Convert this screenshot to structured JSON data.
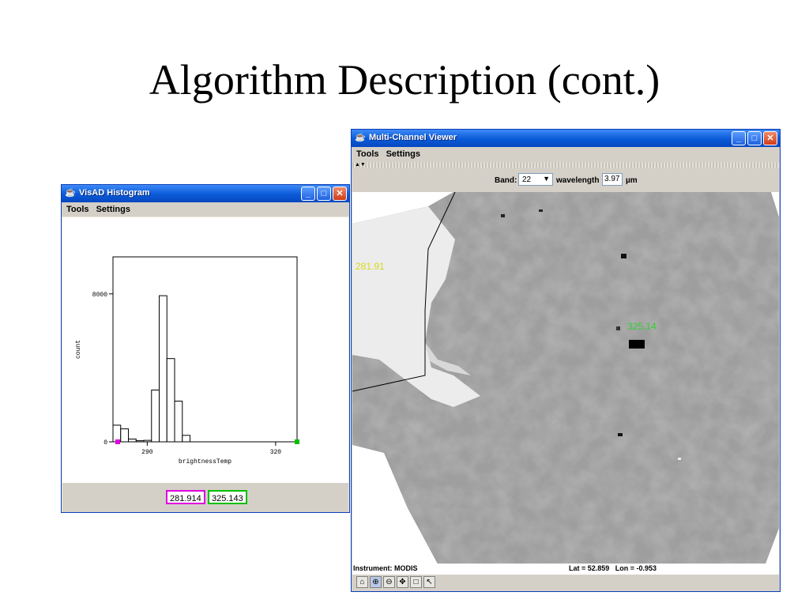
{
  "slide": {
    "title": "Algorithm Description (cont.)"
  },
  "histogram_window": {
    "title": "VisAD Histogram",
    "menu": [
      "Tools",
      "Settings"
    ],
    "low_value": "281.914",
    "high_value": "325.143",
    "colors": {
      "low": "#e000e0",
      "high": "#00c000"
    },
    "chart_data": {
      "type": "bar",
      "xlabel": "brightnessTemp",
      "ylabel": "count",
      "ylim": [
        0,
        10000
      ],
      "y_ticks": [
        0,
        8000
      ],
      "y_tick_labels": [
        "0",
        "8000"
      ],
      "x_ticks": [
        290,
        320
      ],
      "x_tick_labels": [
        "290",
        "320"
      ],
      "xlim": [
        282,
        325
      ],
      "bins": [
        {
          "x0": 282,
          "x1": 283.8,
          "count": 900
        },
        {
          "x0": 283.8,
          "x1": 285.6,
          "count": 700
        },
        {
          "x0": 285.6,
          "x1": 287.4,
          "count": 150
        },
        {
          "x0": 287.4,
          "x1": 289.2,
          "count": 60
        },
        {
          "x0": 289.2,
          "x1": 291.0,
          "count": 80
        },
        {
          "x0": 291.0,
          "x1": 292.8,
          "count": 2800
        },
        {
          "x0": 292.8,
          "x1": 294.6,
          "count": 7900
        },
        {
          "x0": 294.6,
          "x1": 296.4,
          "count": 4500
        },
        {
          "x0": 296.4,
          "x1": 298.2,
          "count": 2200
        },
        {
          "x0": 298.2,
          "x1": 300.0,
          "count": 350
        }
      ]
    }
  },
  "viewer_window": {
    "title": "Multi-Channel Viewer",
    "menu": [
      "Tools",
      "Settings"
    ],
    "band_label": "Band:",
    "band_value": "22",
    "wavelength_label": "wavelength",
    "wavelength_value": "3.97",
    "wavelength_unit": "µm",
    "low_label": "281.91",
    "high_label": "325.14",
    "label_colors": {
      "low": "#d8d820",
      "high": "#30d030"
    },
    "instrument": "Instrument: MODIS",
    "latlon": "Lat = 52.859   Lon = -0.953",
    "tools": [
      "home-icon",
      "zoom-in-icon",
      "zoom-out-icon",
      "pan-icon",
      "select-box-icon",
      "pointer-icon"
    ]
  }
}
